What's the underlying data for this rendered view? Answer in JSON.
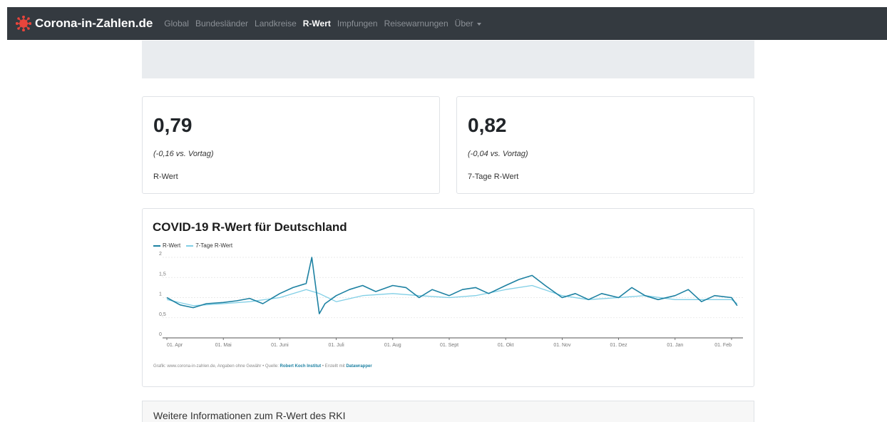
{
  "navbar": {
    "brand": "Corona-in-Zahlen.de",
    "brand_icon": "virus-icon",
    "links": [
      "Global",
      "Bundesländer",
      "Landkreise",
      "R-Wert",
      "Impfungen",
      "Reisewarnungen",
      "Über"
    ],
    "active_link": "R-Wert",
    "colors": {
      "background": "#343a40",
      "link": "#8b9096",
      "active": "#ffffff",
      "brand_icon": "#e8453c"
    }
  },
  "cards": [
    {
      "value": "0,79",
      "change": "(-0,16 vs. Vortag)",
      "label": "R-Wert"
    },
    {
      "value": "0,82",
      "change": "(-0,04 vs. Vortag)",
      "label": "7-Tage R-Wert"
    }
  ],
  "chart": {
    "title": "COVID-19 R-Wert für Deutschland",
    "footer_prefix": "Grafik: www.corona-in-zahlen.de, Angaben ohne Gewähr • Quelle: ",
    "footer_source": "Robert Koch Institut",
    "footer_mid": " • Erstellt mit ",
    "footer_tool": "Datawrapper"
  },
  "chart_data": {
    "type": "line",
    "title": "COVID-19 R-Wert für Deutschland",
    "xlabel": "",
    "ylabel": "",
    "ylim": [
      0,
      2
    ],
    "y_ticks": [
      "0",
      "0,5",
      "1",
      "1,5",
      "2"
    ],
    "x_ticks": [
      "01. Apr",
      "01. Mai",
      "01. Juni",
      "01. Juli",
      "01. Aug",
      "01. Sept",
      "01. Okt",
      "01. Nov",
      "01. Dez",
      "01. Jan",
      "01. Feb"
    ],
    "grid": true,
    "legend_position": "top-left",
    "series": [
      {
        "name": "R-Wert",
        "color": "#1d81a2",
        "x": [
          "01. Apr",
          "08. Apr",
          "15. Apr",
          "22. Apr",
          "01. Mai",
          "08. Mai",
          "15. Mai",
          "22. Mai",
          "01. Juni",
          "08. Juni",
          "15. Juni",
          "18. Juni",
          "22. Juni",
          "25. Juni",
          "01. Juli",
          "08. Juli",
          "15. Juli",
          "22. Juli",
          "01. Aug",
          "08. Aug",
          "15. Aug",
          "22. Aug",
          "01. Sept",
          "08. Sept",
          "15. Sept",
          "22. Sept",
          "01. Okt",
          "08. Okt",
          "15. Okt",
          "22. Okt",
          "01. Nov",
          "08. Nov",
          "15. Nov",
          "22. Nov",
          "01. Dez",
          "08. Dez",
          "15. Dez",
          "22. Dez",
          "01. Jan",
          "08. Jan",
          "15. Jan",
          "22. Jan",
          "01. Feb",
          "04. Feb"
        ],
        "values": [
          1.0,
          0.82,
          0.75,
          0.85,
          0.88,
          0.92,
          0.98,
          0.85,
          1.1,
          1.25,
          1.35,
          2.0,
          0.6,
          0.85,
          1.05,
          1.2,
          1.3,
          1.15,
          1.3,
          1.25,
          1.0,
          1.2,
          1.05,
          1.2,
          1.25,
          1.1,
          1.3,
          1.45,
          1.55,
          1.3,
          1.0,
          1.1,
          0.95,
          1.1,
          1.0,
          1.25,
          1.05,
          0.95,
          1.05,
          1.2,
          0.9,
          1.05,
          1.0,
          0.8
        ]
      },
      {
        "name": "7-Tage R-Wert",
        "color": "#81cfe6",
        "x": [
          "01. Apr",
          "15. Apr",
          "01. Mai",
          "15. Mai",
          "01. Juni",
          "15. Juni",
          "22. Juni",
          "01. Juli",
          "15. Juli",
          "01. Aug",
          "15. Aug",
          "01. Sept",
          "15. Sept",
          "01. Okt",
          "15. Okt",
          "01. Nov",
          "15. Nov",
          "01. Dez",
          "15. Dez",
          "01. Jan",
          "15. Jan",
          "01. Feb",
          "04. Feb"
        ],
        "values": [
          0.95,
          0.8,
          0.85,
          0.9,
          1.0,
          1.2,
          1.1,
          0.9,
          1.05,
          1.1,
          1.05,
          1.0,
          1.05,
          1.2,
          1.3,
          1.05,
          0.95,
          1.0,
          1.05,
          0.95,
          0.95,
          0.95,
          0.85
        ]
      }
    ]
  },
  "info": {
    "title": "Weitere Informationen zum R-Wert des RKI"
  }
}
